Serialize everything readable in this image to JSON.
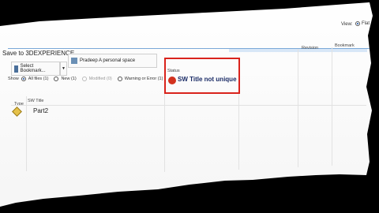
{
  "window": {
    "title": "Save to 3DEXPERIENCE"
  },
  "view": {
    "label": "View:",
    "option": "Flat",
    "selected": true
  },
  "toolbar": {
    "bookmark_label": "Select Bookmark...",
    "space_label": "Pradeep A personal space"
  },
  "columns": {
    "revision": "Revision",
    "bookmark": "Bookmark",
    "status": "Status",
    "type": "Type",
    "sw_title": "SW Title"
  },
  "filters": {
    "show_label": "Show",
    "options": [
      {
        "label": "All files (1)",
        "selected": true,
        "enabled": true
      },
      {
        "label": "New (1)",
        "selected": false,
        "enabled": true
      },
      {
        "label": "Modified (0)",
        "selected": false,
        "enabled": false
      },
      {
        "label": "Warning or Error (1)",
        "selected": false,
        "enabled": true
      }
    ]
  },
  "rows": [
    {
      "sw_title": "Part2",
      "status": "SW Title not unique",
      "status_color": "#d2321e"
    }
  ],
  "colors": {
    "highlight": "#d9231c",
    "accent": "#1a4fa0"
  },
  "icons": {
    "bookmark": "bookmark-icon",
    "space": "collab-space-icon",
    "part": "part-icon",
    "error": "error-icon"
  }
}
